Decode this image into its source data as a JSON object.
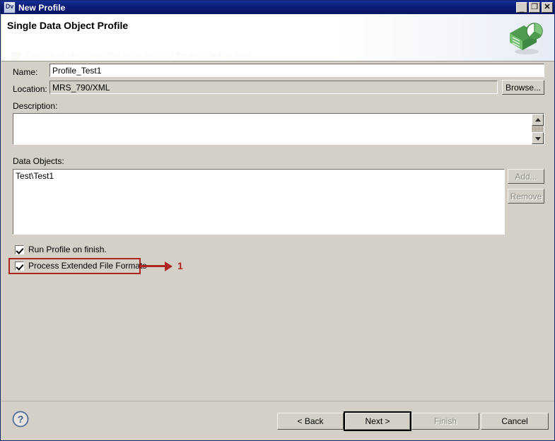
{
  "window": {
    "app_icon_label": "Dv",
    "title": "New Profile",
    "minimize_label": "_",
    "maximize_label": "❐",
    "close_label": "✕"
  },
  "header": {
    "title": "Single Data Object Profile",
    "subtitle": "There is an object with the same name at the specified location.",
    "graphic_name": "profile-document-chart-icon"
  },
  "form": {
    "name_label": "Name:",
    "name_value": "Profile_Test1",
    "location_label": "Location:",
    "location_value": "MRS_790/XML",
    "browse_label": "Browse...",
    "description_label": "Description:",
    "description_value": "",
    "data_objects_label": "Data Objects:",
    "data_objects": [
      "Test\\Test1"
    ],
    "add_label": "Add...",
    "remove_label": "Remove"
  },
  "options": {
    "run_profile_label": "Run Profile on finish.",
    "run_profile_checked": true,
    "extended_formats_label": "Process Extended File Formats",
    "extended_formats_checked": true
  },
  "annotation": {
    "number": "1",
    "color": "#b02323"
  },
  "footer": {
    "help_label": "?",
    "back_label": "< Back",
    "next_label": "Next >",
    "finish_label": "Finish",
    "cancel_label": "Cancel"
  },
  "colors": {
    "titlebar": "#0b1b72",
    "dialog_bg": "#d4d0c8",
    "annotation_red": "#b02323",
    "help_blue": "#4a6a9a"
  }
}
